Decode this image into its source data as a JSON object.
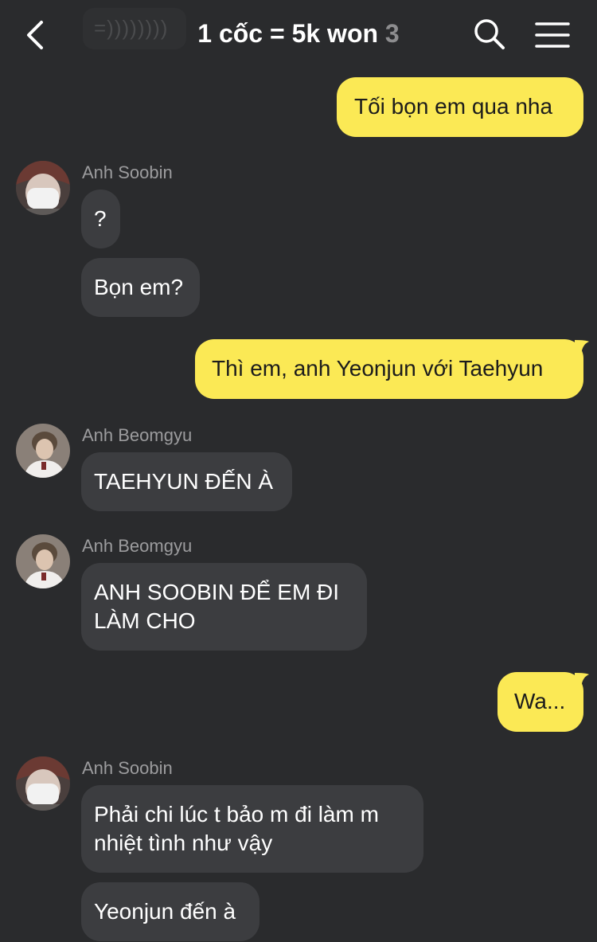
{
  "header": {
    "back_icon": "chevron-left-icon",
    "title": "1 cốc = 5k won",
    "member_count": "3",
    "search_icon": "search-icon",
    "menu_icon": "menu-icon",
    "ghost_text": "=))))))))"
  },
  "colors": {
    "background": "#2a2b2d",
    "incoming_bubble": "#3c3d40",
    "outgoing_bubble": "#fbe955",
    "sender_name": "#9c9c9e"
  },
  "messages": [
    {
      "direction": "out",
      "text": "Tối bọn em qua nha"
    },
    {
      "direction": "in",
      "sender": "Anh Soobin",
      "avatar": "avatar-soobin",
      "texts": [
        "?",
        "Bọn em?"
      ]
    },
    {
      "direction": "out",
      "text": "Thì em, anh Yeonjun với Taehyun"
    },
    {
      "direction": "in",
      "sender": "Anh Beomgyu",
      "avatar": "avatar-beomgyu",
      "texts": [
        "TAEHYUN ĐẾN À"
      ]
    },
    {
      "direction": "in",
      "sender": "Anh Beomgyu",
      "avatar": "avatar-beomgyu",
      "texts": [
        "ANH SOOBIN ĐỂ EM ĐI\nLÀM CHO"
      ]
    },
    {
      "direction": "out",
      "text": "Wa..."
    },
    {
      "direction": "in",
      "sender": "Anh Soobin",
      "avatar": "avatar-soobin",
      "texts": [
        "Phải chi lúc t bảo m đi làm m\nnhiệt tình như vậy",
        "Yeonjun đến à"
      ]
    }
  ]
}
